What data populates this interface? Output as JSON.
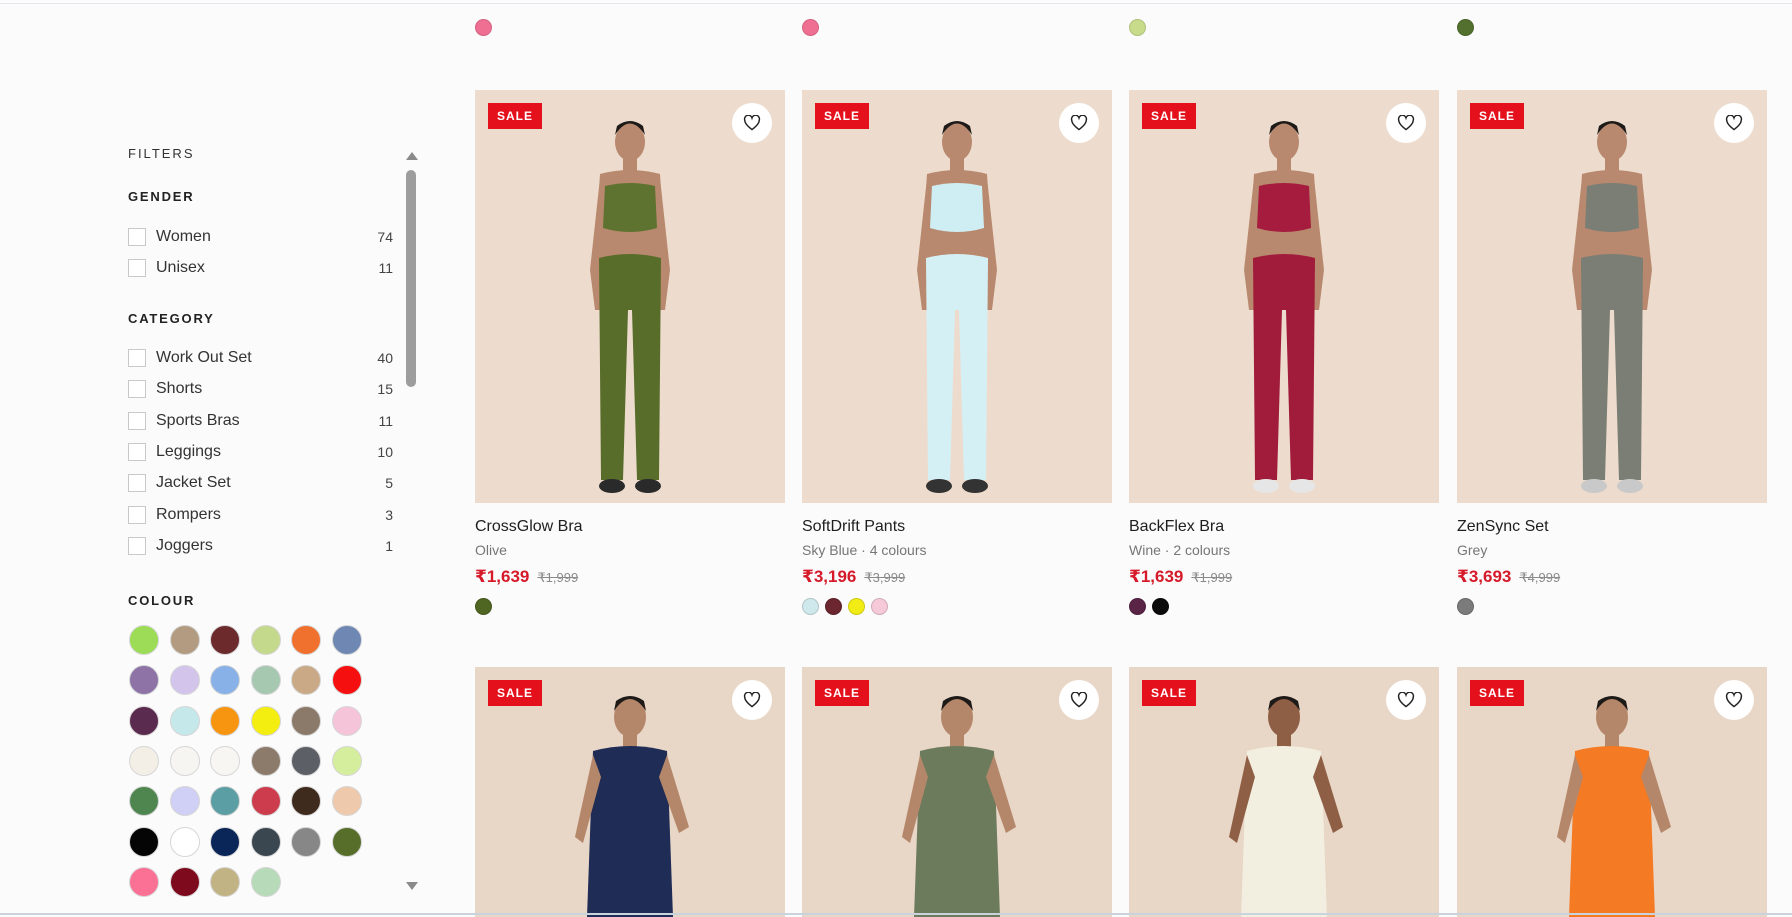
{
  "filters": {
    "title": "FILTERS",
    "gender": {
      "title": "GENDER",
      "options": [
        {
          "label": "Women",
          "count": "74"
        },
        {
          "label": "Unisex",
          "count": "11"
        }
      ]
    },
    "category": {
      "title": "CATEGORY",
      "options": [
        {
          "label": "Work Out Set",
          "count": "40"
        },
        {
          "label": "Shorts",
          "count": "15"
        },
        {
          "label": "Sports Bras",
          "count": "11"
        },
        {
          "label": "Leggings",
          "count": "10"
        },
        {
          "label": "Jacket Set",
          "count": "5"
        },
        {
          "label": "Rompers",
          "count": "3"
        },
        {
          "label": "Joggers",
          "count": "1"
        }
      ]
    },
    "colour": {
      "title": "COLOUR",
      "swatches": [
        "#9ddc56",
        "#b39b82",
        "#6d2a2c",
        "#c5d98d",
        "#f0712e",
        "#6f88b3",
        "#8e73a6",
        "#d3c4eb",
        "#88b1e8",
        "#a7c8b0",
        "#caa987",
        "#f50f0f",
        "#5a2a4f",
        "#c5e8ea",
        "#f89510",
        "#f3ee10",
        "#8b7a6a",
        "#f5c4d8",
        "#f3efe6",
        "#f6f5f2",
        "#f7f6f3",
        "#8c7a6b",
        "#5c5f66",
        "#d5ee9d",
        "#4f8650",
        "#d0cff5",
        "#5b9ea3",
        "#cc3c4d",
        "#3f2a1e",
        "#efc9ab",
        "#050505",
        "#ffffff",
        "#0a2557",
        "#3a4650",
        "#878787",
        "#576e2a",
        "#fb7196",
        "#7e0a1e",
        "#c2b384",
        "#b7dbb8"
      ]
    }
  },
  "top_row": {
    "dot_colors": [
      "#ef6f92",
      "#ef6f92",
      "#c7db8a",
      "#53702f"
    ]
  },
  "products": [
    {
      "name": "CrossGlow Bra",
      "subtitle": "Olive",
      "price": "₹1,639",
      "was": "₹1,999",
      "badge": "SALE",
      "colors": [
        "#4f6522"
      ],
      "bg": "#eddccd",
      "skin": "#b8896e",
      "top": "#5f7330",
      "bottom": "#586d2a",
      "shoe": "#2a2a2a"
    },
    {
      "name": "SoftDrift Pants",
      "subtitle": "Sky Blue · 4 colours",
      "price": "₹3,196",
      "was": "₹3,999",
      "badge": "SALE",
      "colors": [
        "#cfe8ec",
        "#6b2630",
        "#f1ec14",
        "#f5c9d8"
      ],
      "bg": "#eddccd",
      "skin": "#b8896e",
      "top": "#cfeef3",
      "bottom": "#d5f0f5",
      "shoe": "#333333"
    },
    {
      "name": "BackFlex Bra",
      "subtitle": "Wine · 2 colours",
      "price": "₹1,639",
      "was": "₹1,999",
      "badge": "SALE",
      "colors": [
        "#5a2446",
        "#0b0b0b"
      ],
      "bg": "#eddccd",
      "skin": "#b8896e",
      "top": "#a51c3e",
      "bottom": "#a11c3b",
      "shoe": "#e6e6e6"
    },
    {
      "name": "ZenSync Set",
      "subtitle": "Grey",
      "price": "₹3,693",
      "was": "₹4,999",
      "badge": "SALE",
      "colors": [
        "#7b7b7b"
      ],
      "bg": "#eddccd",
      "skin": "#b8896e",
      "top": "#7a7e74",
      "bottom": "#7a7e74",
      "shoe": "#c9c9c9"
    }
  ],
  "products_row2": [
    {
      "badge": "SALE",
      "bg": "#e8d6c7",
      "skin": "#b5876a",
      "garment": "#1f2c55"
    },
    {
      "badge": "SALE",
      "bg": "#e8d6c7",
      "skin": "#b5876a",
      "garment": "#6d7b5d"
    },
    {
      "badge": "SALE",
      "bg": "#e8d6c7",
      "skin": "#8e5f45",
      "garment": "#f2efe0"
    },
    {
      "badge": "SALE",
      "bg": "#e8d6c7",
      "skin": "#b5876a",
      "garment": "#f47a24"
    }
  ]
}
